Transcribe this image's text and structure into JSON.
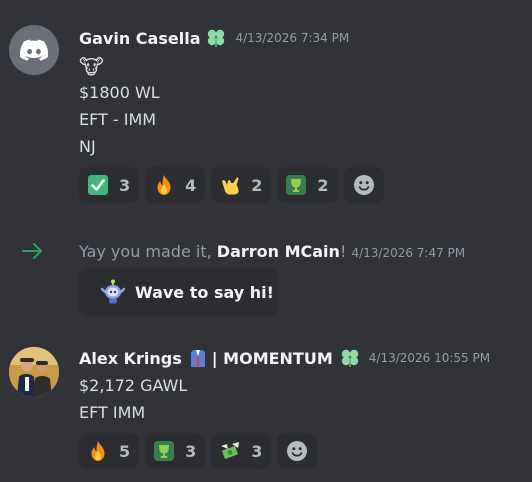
{
  "messages": [
    {
      "author": "Gavin Casella",
      "timestamp": "4/13/2026 7:34 PM",
      "avatar_icon": "discord-logo-icon",
      "lines": [
        "🐮",
        "$1800 WL",
        "EFT - IMM",
        "NJ"
      ],
      "reactions": [
        {
          "icon": "check-mark-icon",
          "count": "3"
        },
        {
          "icon": "fire-icon",
          "count": "4"
        },
        {
          "icon": "call-me-hand-icon",
          "count": "2"
        },
        {
          "icon": "trophy-icon",
          "count": "2"
        }
      ]
    },
    {
      "author": "Alex Krings",
      "author_suffix": "| MOMENTUM",
      "timestamp": "4/13/2026 10:55 PM",
      "lines": [
        "$2,172 GAWL",
        "EFT IMM"
      ],
      "reactions": [
        {
          "icon": "fire-icon",
          "count": "5"
        },
        {
          "icon": "trophy-icon",
          "count": "3"
        },
        {
          "icon": "money-wings-icon",
          "count": "3"
        }
      ]
    }
  ],
  "join": {
    "prefix": "Yay you made it, ",
    "name": "Darron MCain",
    "suffix": "!",
    "timestamp": "4/13/2026 7:47 PM",
    "wave_label": "Wave to say hi!"
  },
  "colors": {
    "background": "#313338",
    "reaction_bg": "#2b2d31",
    "join_arrow": "#23a55a",
    "role_icon": "#8fd8a8"
  }
}
